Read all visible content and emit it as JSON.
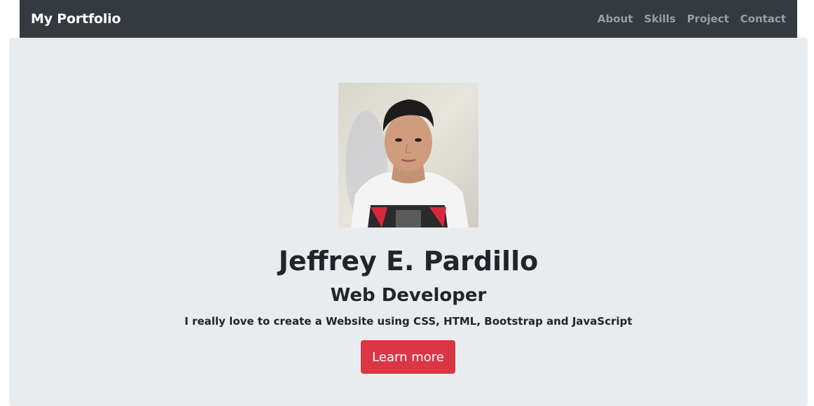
{
  "navbar": {
    "brand": "My Portfolio",
    "links": [
      "About",
      "Skills",
      "Project",
      "Contact"
    ]
  },
  "hero": {
    "name": "Jeffrey E. Pardillo",
    "role": "Web Developer",
    "tagline": "I really love to create a Website using CSS, HTML, Bootstrap and JavaScript",
    "button_label": "Learn more"
  },
  "colors": {
    "navbar_bg": "#343a40",
    "hero_bg": "#e9ecef",
    "button_bg": "#dc3545"
  }
}
